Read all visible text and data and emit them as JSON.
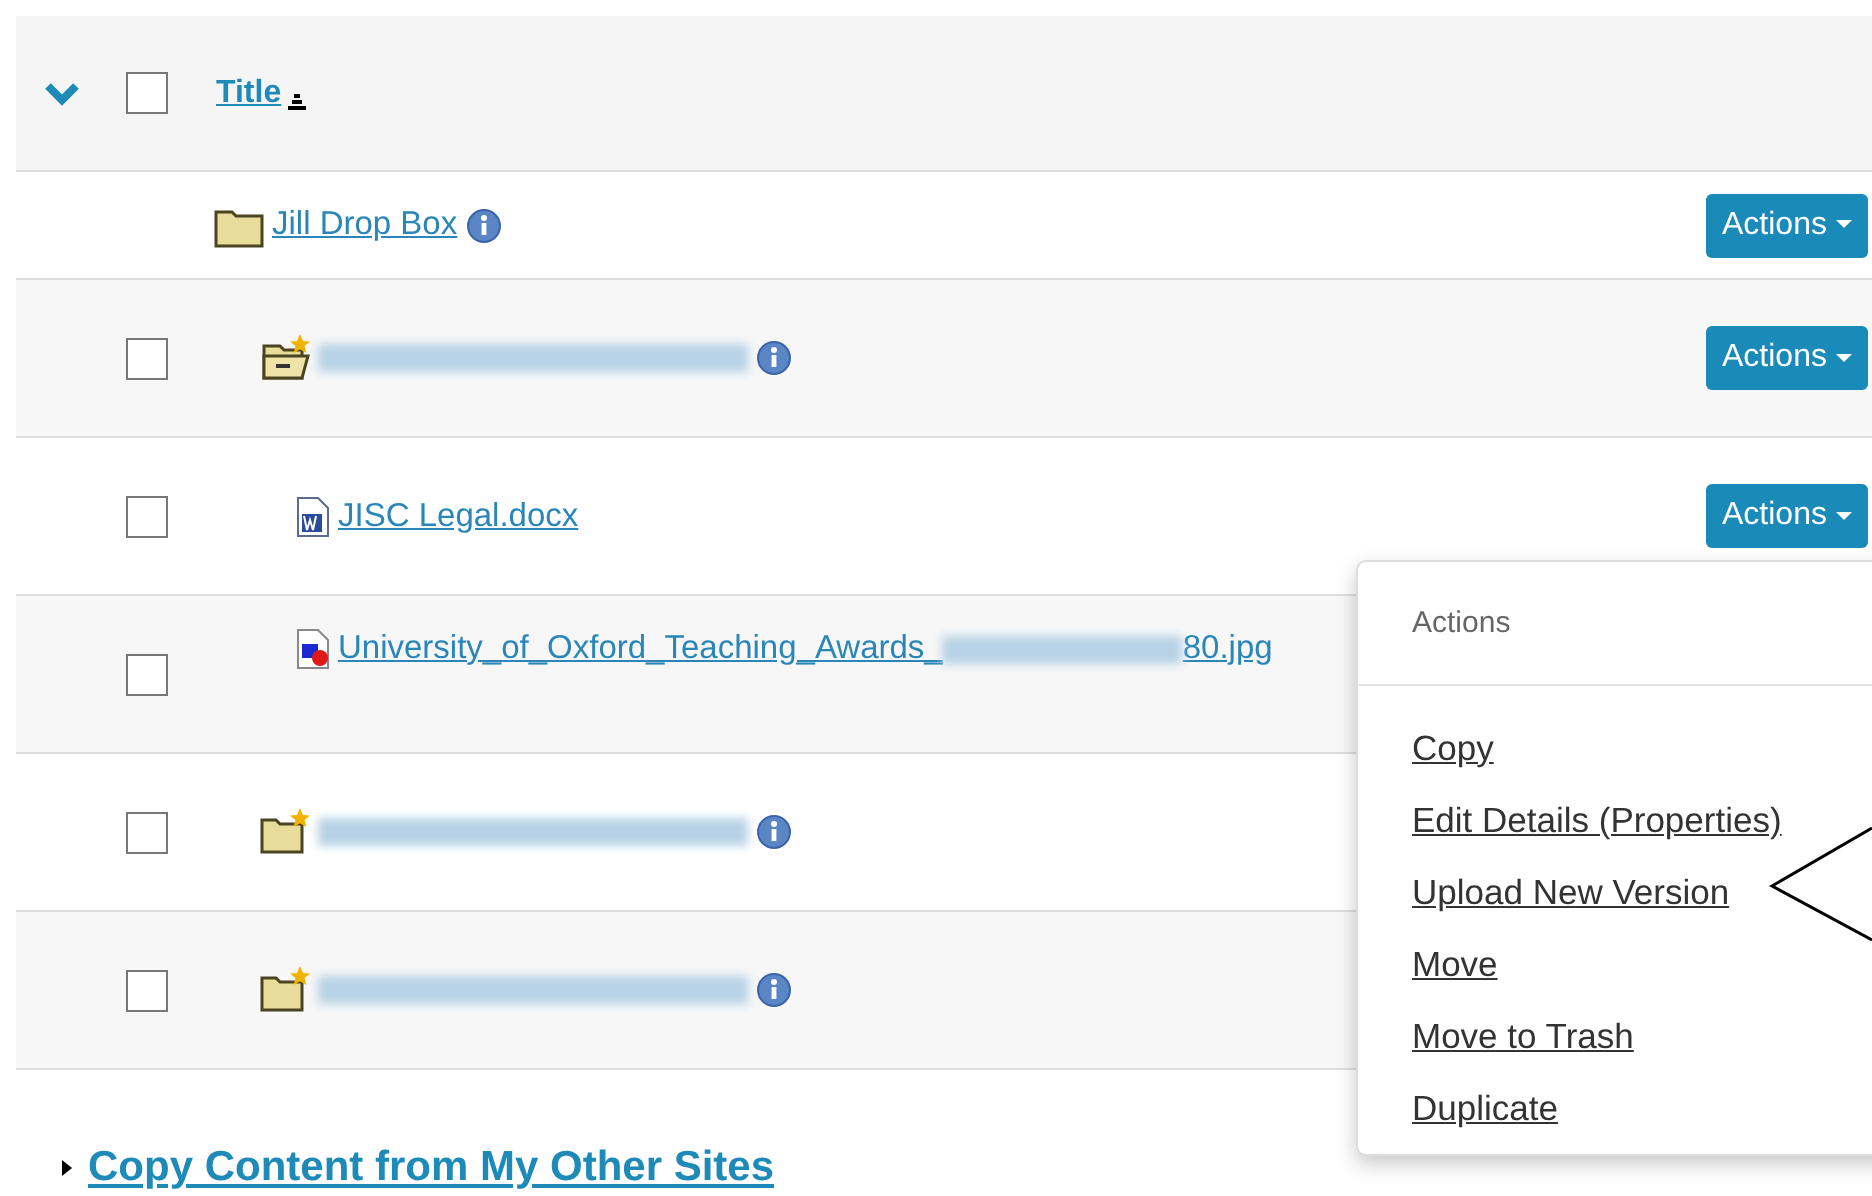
{
  "header": {
    "expanded": true,
    "checked": false,
    "title": "Title"
  },
  "items": [
    {
      "kind": "folder",
      "name": "Jill Drop Box",
      "info": true,
      "actions": "Actions",
      "children": [
        {
          "kind": "folder-open-star",
          "redacted": true,
          "info": true,
          "checked": false,
          "actions": "Actions",
          "children": [
            {
              "kind": "word",
              "name": "JISC Legal.docx",
              "checked": false,
              "actions": "Actions"
            },
            {
              "kind": "image",
              "name": "University_of_Oxford_Teaching_Awards_",
              "redacted": true,
              "name_end": "80.jpg",
              "checked": false
            }
          ]
        },
        {
          "kind": "folder-star",
          "redacted": true,
          "info": true,
          "checked": false
        },
        {
          "kind": "folder-star",
          "redacted": true,
          "info": true,
          "checked": false
        }
      ]
    }
  ],
  "menu": {
    "title": "Actions",
    "items": [
      "Copy",
      "Edit Details (Properties)",
      "Upload New Version",
      "Move",
      "Move to Trash",
      "Duplicate"
    ]
  },
  "footer": {
    "expanded": false,
    "label": "Copy Content from My Other Sites"
  }
}
